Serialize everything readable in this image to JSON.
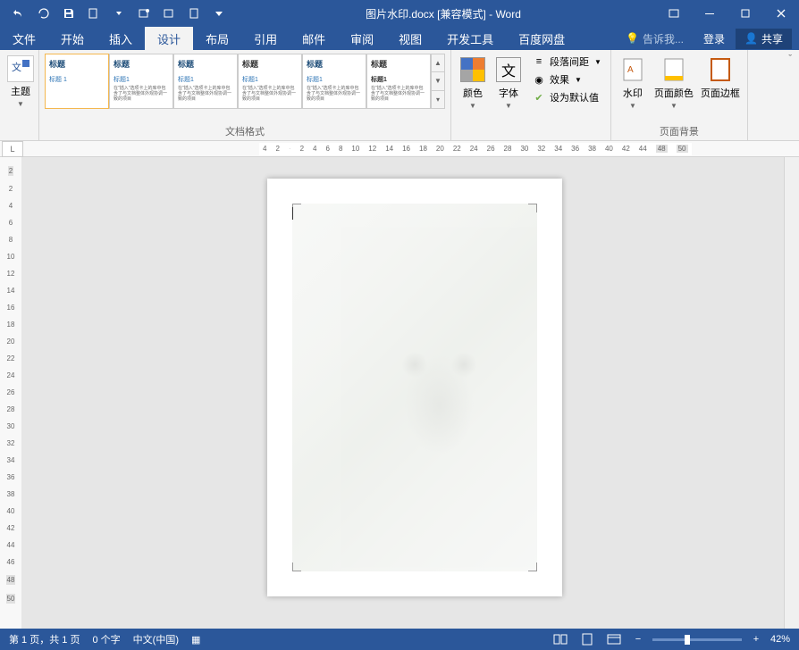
{
  "titlebar": {
    "title": "图片水印.docx [兼容模式] - Word"
  },
  "tabs": {
    "file": "文件",
    "home": "开始",
    "insert": "插入",
    "design": "设计",
    "layout": "布局",
    "references": "引用",
    "mailings": "邮件",
    "review": "审阅",
    "view": "视图",
    "developer": "开发工具",
    "baidu": "百度网盘",
    "tellme": "告诉我...",
    "login": "登录",
    "share": "共享"
  },
  "ribbon": {
    "theme": "主题",
    "doc_format": "文档格式",
    "colors": "颜色",
    "fonts": "字体",
    "para_spacing": "段落间距",
    "effects": "效果",
    "set_default": "设为默认值",
    "watermark": "水印",
    "page_color": "页面颜色",
    "page_border": "页面边框",
    "page_bg": "页面背景",
    "style_title": "标题",
    "style_h1": "标题 1",
    "style_h1b": "标题1"
  },
  "ruler_h": [
    "4",
    "2",
    "2",
    "4",
    "6",
    "8",
    "10",
    "12",
    "14",
    "16",
    "18",
    "20",
    "22",
    "24",
    "26",
    "28",
    "30",
    "32",
    "34",
    "36",
    "38",
    "40",
    "42",
    "44",
    "48",
    "50"
  ],
  "ruler_v": [
    "2",
    "2",
    "4",
    "6",
    "8",
    "10",
    "12",
    "14",
    "16",
    "18",
    "20",
    "22",
    "24",
    "26",
    "28",
    "30",
    "32",
    "34",
    "36",
    "38",
    "40",
    "42",
    "44",
    "46",
    "48",
    "50"
  ],
  "statusbar": {
    "page": "第 1 页，共 1 页",
    "words": "0 个字",
    "lang": "中文(中国)",
    "zoom": "42%"
  }
}
